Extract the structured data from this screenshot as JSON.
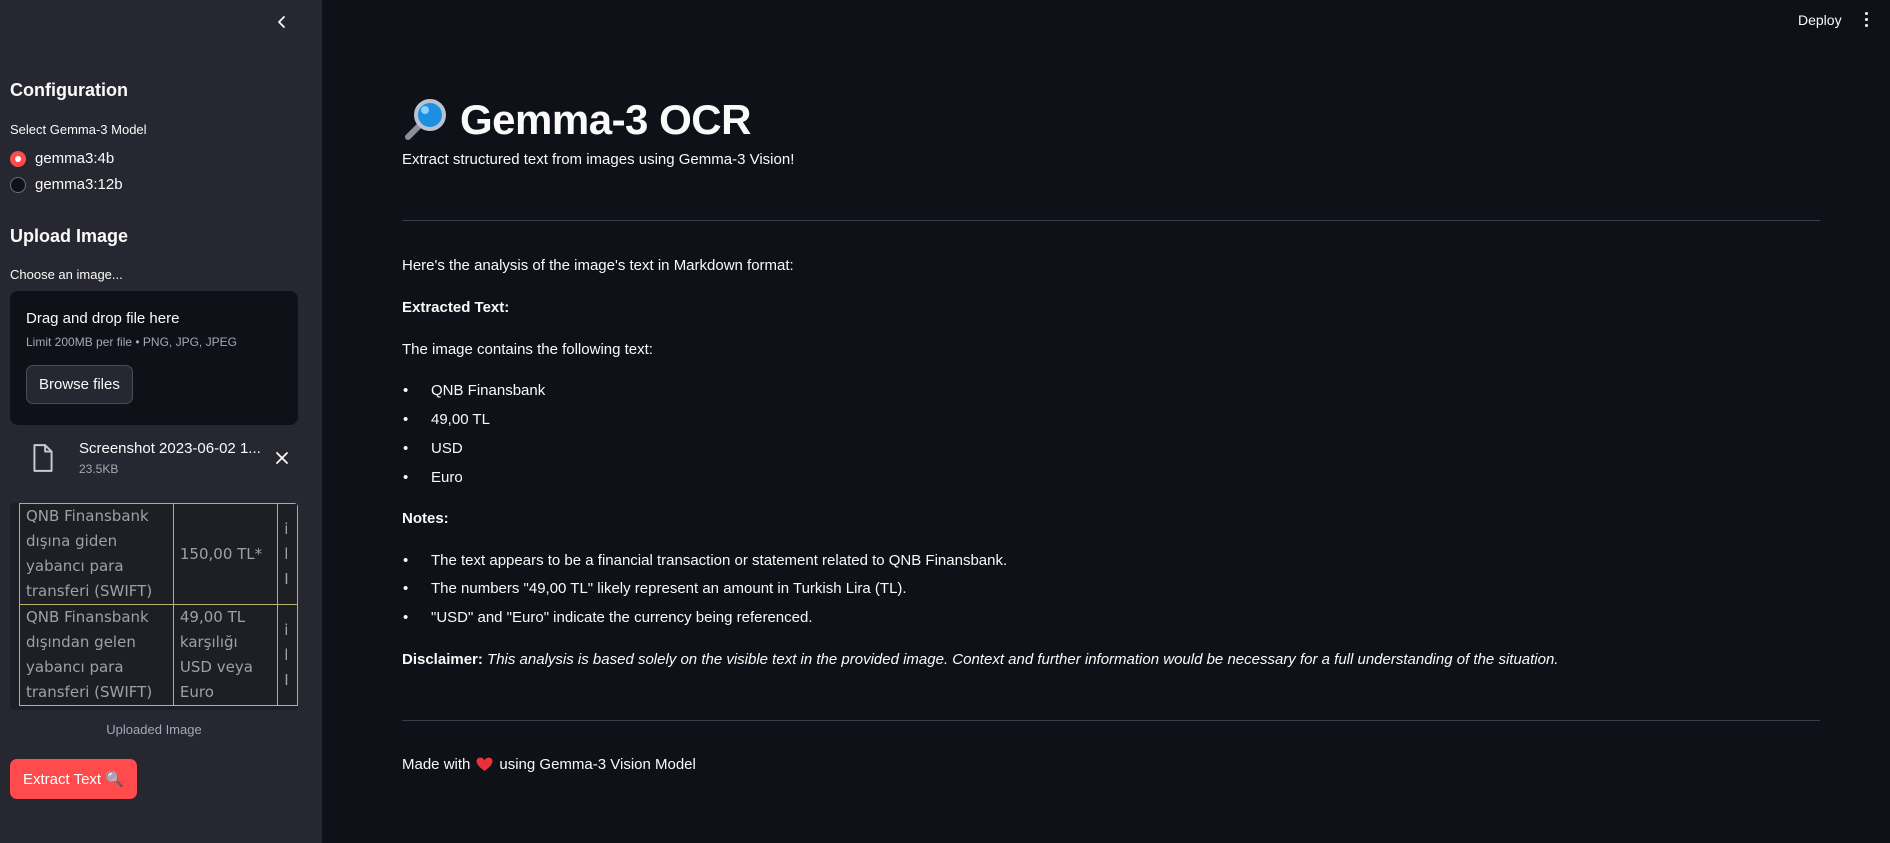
{
  "sidebar": {
    "config_title": "Configuration",
    "model_label": "Select Gemma-3 Model",
    "models": [
      {
        "label": "gemma3:4b",
        "selected": true
      },
      {
        "label": "gemma3:12b",
        "selected": false
      }
    ],
    "upload_title": "Upload Image",
    "choose_label": "Choose an image...",
    "dropzone": {
      "title": "Drag and drop file here",
      "limit": "Limit 200MB per file • PNG, JPG, JPEG",
      "browse_label": "Browse files"
    },
    "file": {
      "name": "Screenshot 2023-06-02 1...",
      "size": "23.5KB"
    },
    "preview": {
      "rows": [
        {
          "c1": [
            "QNB Finansbank",
            "dışına giden",
            "yabancı para",
            "transferi (SWIFT)"
          ],
          "c2": [
            "150,00 TL*"
          ],
          "c3": [
            "i",
            "l",
            "I"
          ]
        },
        {
          "c1": [
            "QNB Finansbank",
            "dışından gelen",
            "yabancı para",
            "transferi (SWIFT)"
          ],
          "c2": [
            "49,00 TL",
            "karşılığı",
            "USD veya",
            "Euro"
          ],
          "c3": [
            "i",
            "l",
            "I"
          ]
        }
      ]
    },
    "caption": "Uploaded Image",
    "extract_label": "Extract Text 🔍"
  },
  "header": {
    "deploy_label": "Deploy"
  },
  "main": {
    "title": "Gemma-3 OCR",
    "subtitle": "Extract structured text from images using Gemma-3 Vision!",
    "intro": "Here's the analysis of the image's text in Markdown format:",
    "extracted_heading": "Extracted Text:",
    "contains": "The image contains the following text:",
    "items": [
      "QNB Finansbank",
      "49,00 TL",
      "USD",
      "Euro"
    ],
    "notes_heading": "Notes:",
    "notes": [
      "The text appears to be a financial transaction or statement related to QNB Finansbank.",
      "The numbers \"49,00 TL\" likely represent an amount in Turkish Lira (TL).",
      "\"USD\" and \"Euro\" indicate the currency being referenced."
    ],
    "disclaimer_label": "Disclaimer:",
    "disclaimer_text": "This analysis is based solely on the visible text in the provided image. Context and further information would be necessary for a full understanding of the situation.",
    "footer_prefix": "Made with",
    "footer_suffix": "using Gemma-3 Vision Model"
  },
  "colors": {
    "background": "#0e1117",
    "sidebar": "#262730",
    "accent": "#ff4b4b"
  }
}
